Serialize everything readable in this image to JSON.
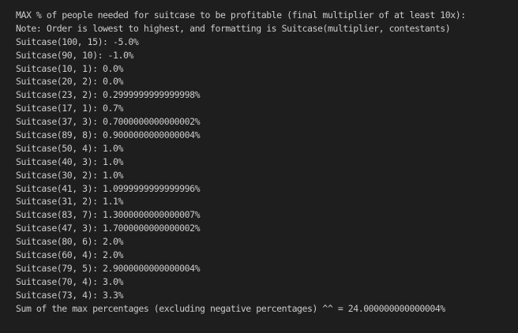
{
  "terminal": {
    "header": "MAX % of people needed for suitcase to be profitable (final multiplier of at least 10x):",
    "note": "Note: Order is lowest to highest, and formatting is Suitcase(multiplier, contestants)",
    "rows": [
      "Suitcase(100, 15): -5.0%",
      "Suitcase(90, 10): -1.0%",
      "Suitcase(10, 1): 0.0%",
      "Suitcase(20, 2): 0.0%",
      "Suitcase(23, 2): 0.2999999999999998%",
      "Suitcase(17, 1): 0.7%",
      "Suitcase(37, 3): 0.7000000000000002%",
      "Suitcase(89, 8): 0.9000000000000004%",
      "Suitcase(50, 4): 1.0%",
      "Suitcase(40, 3): 1.0%",
      "Suitcase(30, 2): 1.0%",
      "Suitcase(41, 3): 1.0999999999999996%",
      "Suitcase(31, 2): 1.1%",
      "Suitcase(83, 7): 1.3000000000000007%",
      "Suitcase(47, 3): 1.7000000000000002%",
      "Suitcase(80, 6): 2.0%",
      "Suitcase(60, 4): 2.0%",
      "Suitcase(79, 5): 2.9000000000000004%",
      "Suitcase(70, 4): 3.0%",
      "Suitcase(73, 4): 3.3%"
    ],
    "sum": "Sum of the max percentages (excluding negative percentages) ^^ = 24.000000000000004%"
  }
}
